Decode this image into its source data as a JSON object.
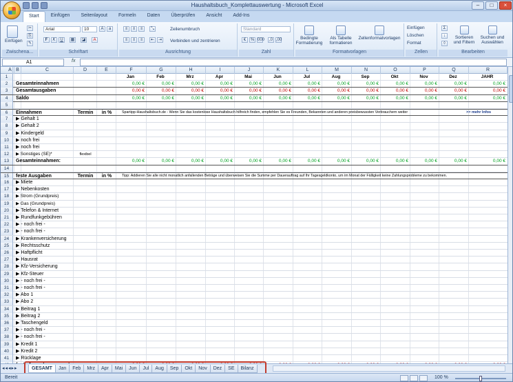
{
  "window": {
    "title": "Haushaltsbuch_Komplettauswertung - Microsoft Excel"
  },
  "ribbon_tabs": [
    "Start",
    "Einfügen",
    "Seitenlayout",
    "Formeln",
    "Daten",
    "Überprüfen",
    "Ansicht",
    "Add-Ins"
  ],
  "ribbon": {
    "clipboard": {
      "label": "Zwischena...",
      "paste": "Einfügen"
    },
    "font": {
      "label": "Schriftart",
      "name": "Arial",
      "size": "10"
    },
    "alignment": {
      "label": "Ausrichtung",
      "wrap": "Zeilenumbruch",
      "merge": "Verbinden und zentrieren"
    },
    "number": {
      "label": "Zahl",
      "format": "Standard"
    },
    "styles": {
      "label": "Formatvorlagen",
      "cond": "Bedingte Formatierung",
      "table": "Als Tabelle formatieren",
      "cell": "Zellenformatvorlagen"
    },
    "cells": {
      "label": "Zellen",
      "insert": "Einfügen",
      "delete": "Löschen",
      "format": "Format"
    },
    "editing": {
      "label": "Bearbeiten",
      "sort": "Sortieren und Filtern",
      "find": "Suchen und Auswählen"
    }
  },
  "formula_bar": {
    "cell_ref": "A1",
    "fx": "fx",
    "value": ""
  },
  "columns": [
    "A",
    "B",
    "C",
    "D",
    "E",
    "F",
    "G",
    "H",
    "I",
    "J",
    "K",
    "L",
    "M",
    "N",
    "O",
    "P",
    "Q",
    "R"
  ],
  "months": [
    "Jan",
    "Feb",
    "Mrz",
    "Apr",
    "Mai",
    "Jun",
    "Jul",
    "Aug",
    "Sep",
    "Okt",
    "Nov",
    "Dez",
    "JAHR"
  ],
  "money_zero": "0,00 €",
  "rows": [
    {
      "n": "1",
      "label": "",
      "bold": false,
      "type": "months"
    },
    {
      "n": "2",
      "label": "Gesamteinnahmen",
      "bold": true,
      "type": "money",
      "color": "grn"
    },
    {
      "n": "3",
      "label": "Gesamtausgaben",
      "bold": true,
      "type": "money",
      "color": "red"
    },
    {
      "n": "4",
      "label": "Saldo",
      "bold": true,
      "type": "money",
      "color": "grn"
    },
    {
      "n": "5",
      "label": "",
      "type": "blank"
    },
    {
      "n": "6",
      "label": "Einnahmen",
      "bold": true,
      "type": "header",
      "termin": "Termin",
      "pct": "in %",
      "note": "Spartipp-Haushaltsbuch.de - Wenn Sie das kostenlose Haushaltsbuch hilfreich finden, empfehlen Sie es Freunden, Bekannten und anderen preisbewussten Verbrauchern weiter",
      "more": ">> mehr Infos"
    },
    {
      "n": "7",
      "label": "▶  Gehalt 1",
      "type": "blank"
    },
    {
      "n": "8",
      "label": "▶  Gehalt 2",
      "type": "blank"
    },
    {
      "n": "9",
      "label": "▶  Kindergeld",
      "type": "blank"
    },
    {
      "n": "10",
      "label": "▶  noch frei",
      "type": "blank"
    },
    {
      "n": "11",
      "label": "▶  noch frei",
      "type": "blank"
    },
    {
      "n": "12",
      "label": "▶  Sonstiges (SE)*",
      "type": "blank",
      "termin": "flexibel"
    },
    {
      "n": "13",
      "label": "Gesamteinnahmen:",
      "bold": true,
      "type": "money",
      "color": "grn"
    },
    {
      "n": "14",
      "label": "",
      "type": "blank"
    },
    {
      "n": "15",
      "label": "feste Ausgaben",
      "bold": true,
      "type": "header",
      "termin": "Termin",
      "pct": "in %",
      "note": "Tipp: Addieren Sie alle nicht monatlich anfallenden Beträge und überweisen Sie die Summe per Dauerauftrag auf Ihr Tagesgeldkonto, um im Monat der Fälligkeit keine Zahlungsprobleme zu bekommen."
    },
    {
      "n": "16",
      "label": "▶  Miete",
      "type": "blank"
    },
    {
      "n": "17",
      "label": "▶  Nebenkosten",
      "type": "blank"
    },
    {
      "n": "18",
      "label": "▶  Strom (Grundpreis)",
      "type": "blank"
    },
    {
      "n": "19",
      "label": "▶  Gas (Grundpreis)",
      "type": "blank"
    },
    {
      "n": "20",
      "label": "▶  Telefon & Internet",
      "type": "blank"
    },
    {
      "n": "21",
      "label": "▶  Rundfunkgebühren",
      "type": "blank"
    },
    {
      "n": "22",
      "label": "▶   - noch frei -",
      "type": "blank"
    },
    {
      "n": "23",
      "label": "▶   - noch frei -",
      "type": "blank"
    },
    {
      "n": "24",
      "label": "▶  Krankenversicherung",
      "type": "blank"
    },
    {
      "n": "25",
      "label": "▶  Rechtsschutz",
      "type": "blank"
    },
    {
      "n": "26",
      "label": "▶  Haftpflicht",
      "type": "blank"
    },
    {
      "n": "27",
      "label": "▶  Hausrat",
      "type": "blank"
    },
    {
      "n": "28",
      "label": "▶  Kfz-Versicherung",
      "type": "blank"
    },
    {
      "n": "29",
      "label": "▶  Kfz-Steuer",
      "type": "blank"
    },
    {
      "n": "30",
      "label": "▶   - noch frei -",
      "type": "blank"
    },
    {
      "n": "31",
      "label": "▶   - noch frei -",
      "type": "blank"
    },
    {
      "n": "32",
      "label": "▶  Abo 1",
      "type": "blank"
    },
    {
      "n": "33",
      "label": "▶  Abo 2",
      "type": "blank"
    },
    {
      "n": "34",
      "label": "▶  Beitrag 1",
      "type": "blank"
    },
    {
      "n": "35",
      "label": "▶  Beitrag 2",
      "type": "blank"
    },
    {
      "n": "36",
      "label": "▶  Taschengeld",
      "type": "blank"
    },
    {
      "n": "37",
      "label": "▶   - noch frei -",
      "type": "blank"
    },
    {
      "n": "38",
      "label": "▶   - noch frei -",
      "type": "blank"
    },
    {
      "n": "39",
      "label": "▶  Kredit 1",
      "type": "blank"
    },
    {
      "n": "40",
      "label": "▶  Kredit 2",
      "type": "blank"
    },
    {
      "n": "41",
      "label": "▶  Rücklage",
      "type": "blank"
    },
    {
      "n": "42",
      "label": "feste Ausgaben gesamt:",
      "bold": true,
      "type": "money",
      "color": "red"
    }
  ],
  "sheet_tabs": [
    "GESAMT",
    "Jan",
    "Feb",
    "Mrz",
    "Apr",
    "Mai",
    "Jun",
    "Jul",
    "Aug",
    "Sep",
    "Okt",
    "Nov",
    "Dez",
    "SE",
    "Bilanz"
  ],
  "status": {
    "ready": "Bereit",
    "zoom": "100 %"
  },
  "colors": {
    "highlight_box": "#c0392b",
    "income": "#00a020",
    "expense": "#c00000"
  }
}
